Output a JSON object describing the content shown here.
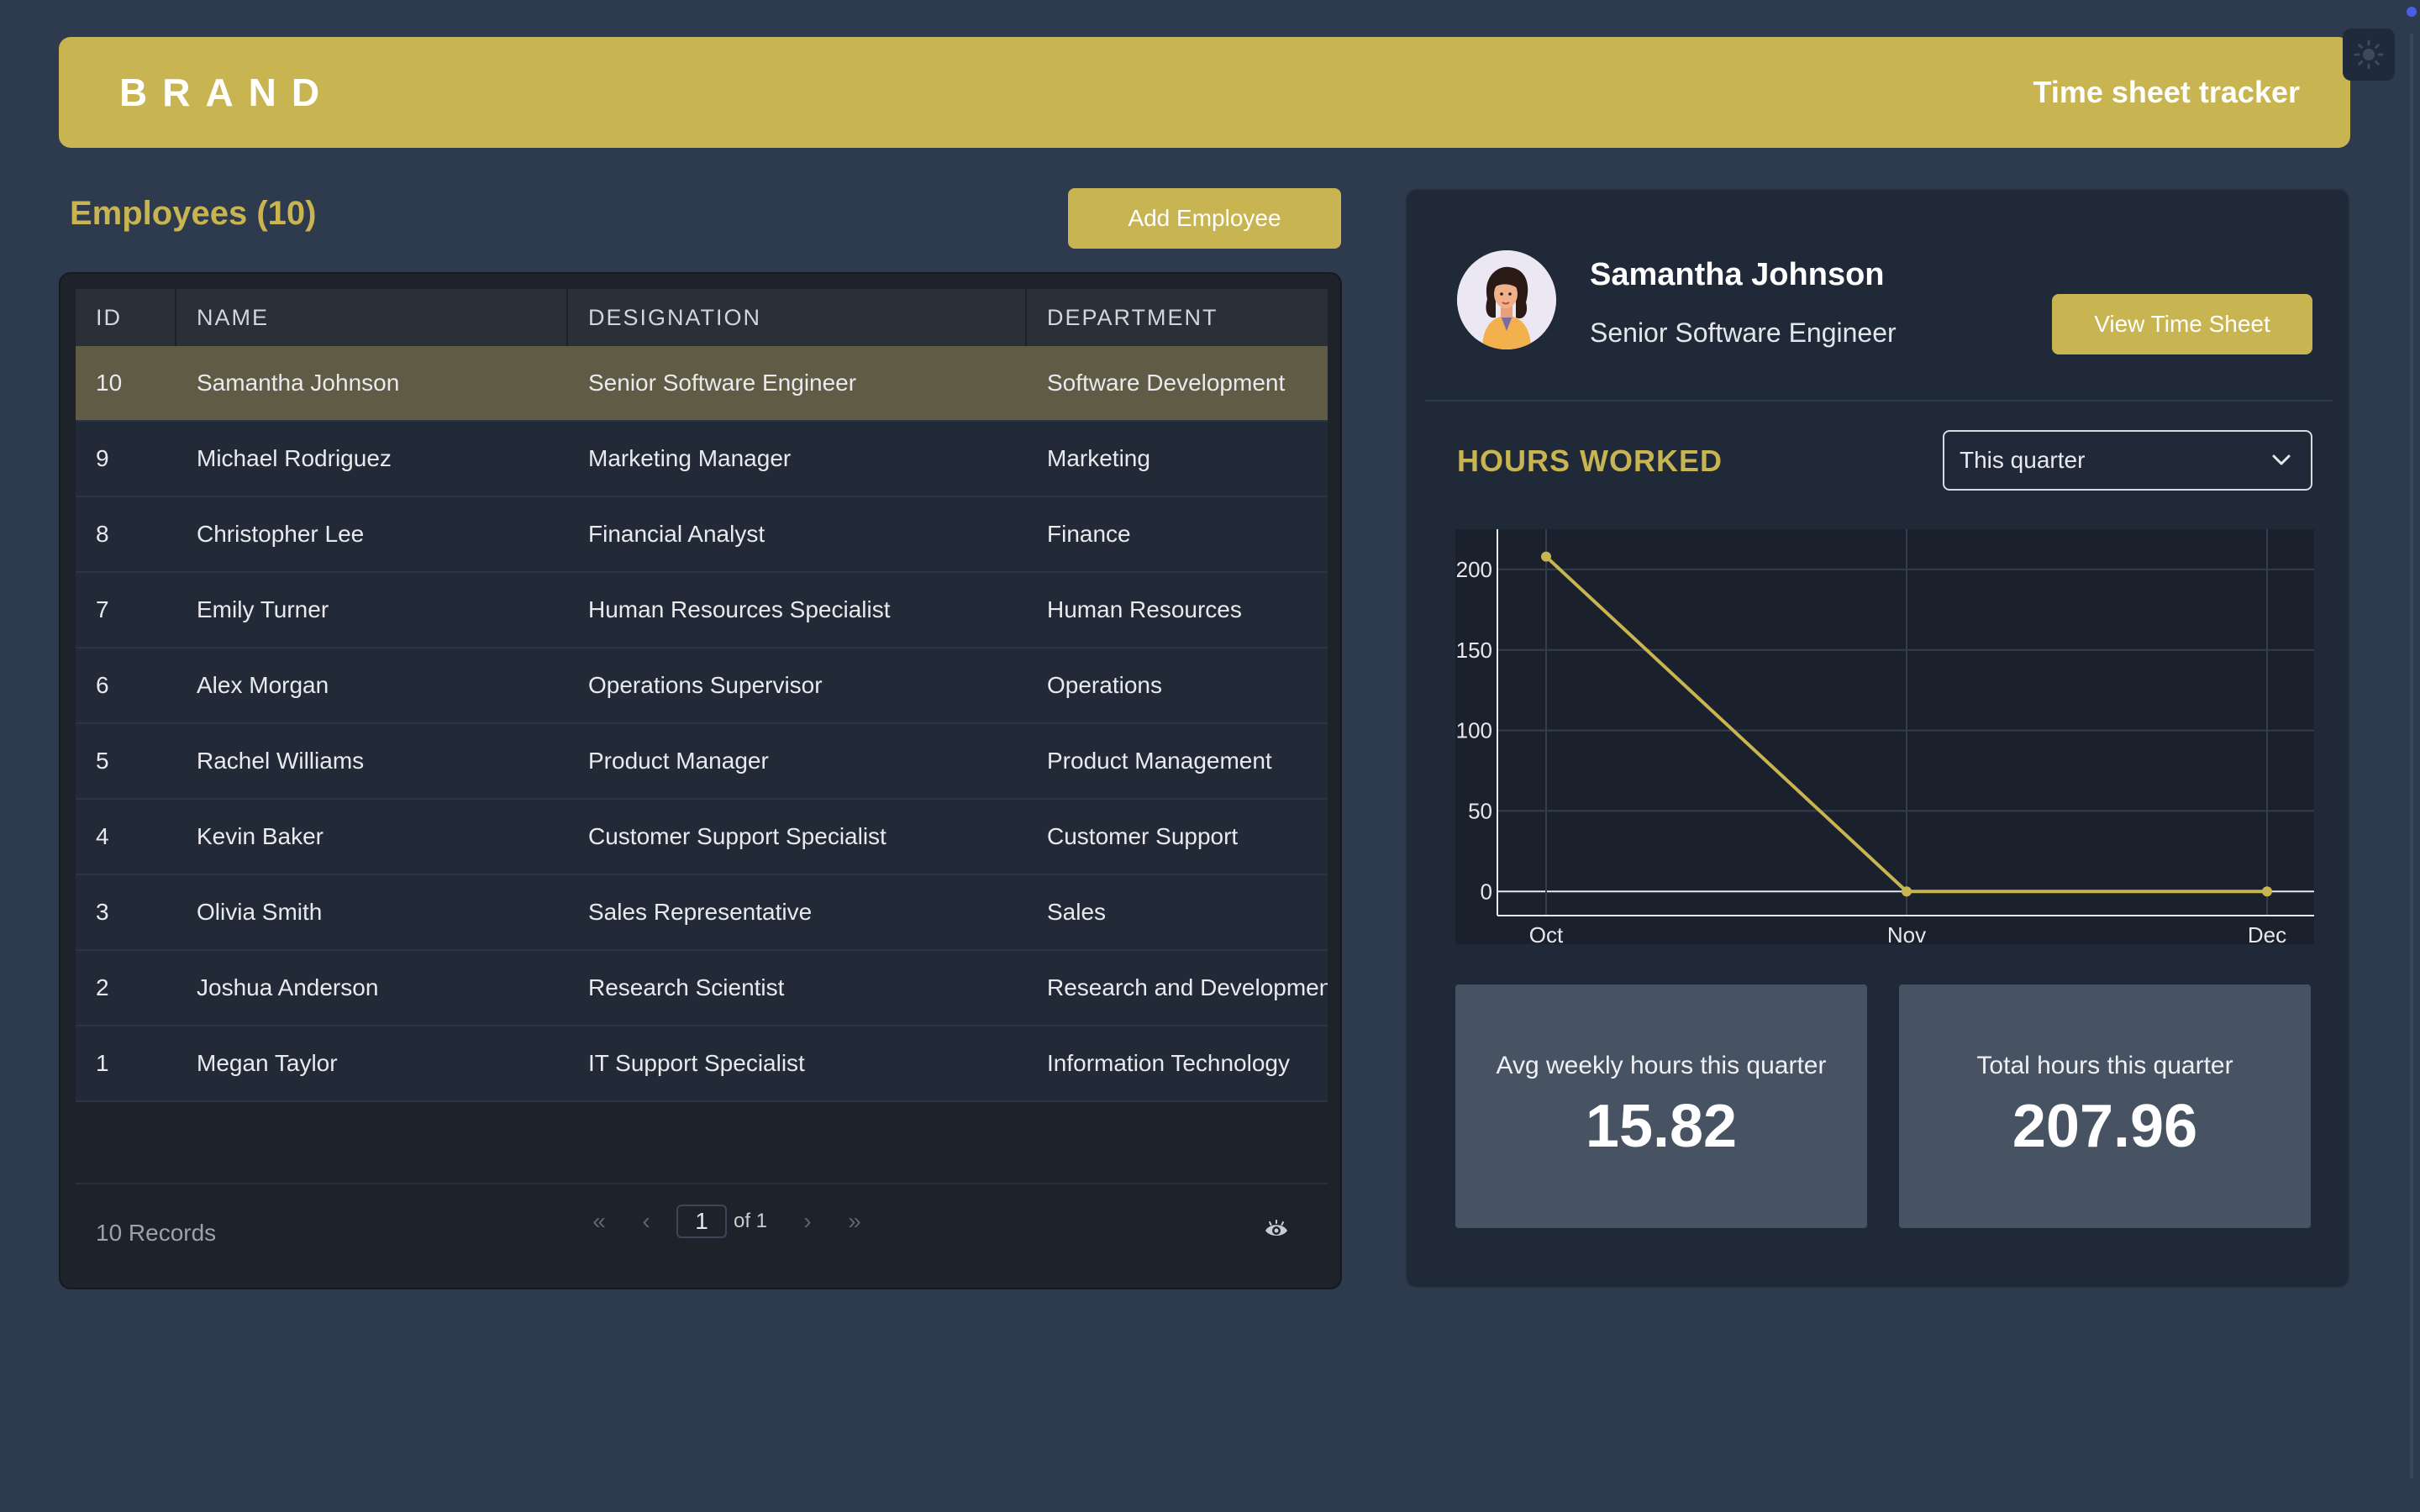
{
  "header": {
    "brand": "BRAND",
    "title": "Time sheet tracker"
  },
  "employees": {
    "title": "Employees (10)",
    "add_button": "Add Employee",
    "columns": [
      "ID",
      "NAME",
      "DESIGNATION",
      "DEPARTMENT"
    ],
    "rows": [
      {
        "id": "10",
        "name": "Samantha Johnson",
        "designation": "Senior Software Engineer",
        "department": "Software Development",
        "selected": true
      },
      {
        "id": "9",
        "name": "Michael Rodriguez",
        "designation": "Marketing Manager",
        "department": "Marketing"
      },
      {
        "id": "8",
        "name": "Christopher Lee",
        "designation": "Financial Analyst",
        "department": "Finance"
      },
      {
        "id": "7",
        "name": "Emily Turner",
        "designation": "Human Resources Specialist",
        "department": "Human Resources"
      },
      {
        "id": "6",
        "name": "Alex Morgan",
        "designation": "Operations Supervisor",
        "department": "Operations"
      },
      {
        "id": "5",
        "name": "Rachel Williams",
        "designation": "Product Manager",
        "department": "Product Management"
      },
      {
        "id": "4",
        "name": "Kevin Baker",
        "designation": "Customer Support Specialist",
        "department": "Customer Support"
      },
      {
        "id": "3",
        "name": "Olivia Smith",
        "designation": "Sales Representative",
        "department": "Sales"
      },
      {
        "id": "2",
        "name": "Joshua Anderson",
        "designation": "Research Scientist",
        "department": "Research and Developmen"
      },
      {
        "id": "1",
        "name": "Megan Taylor",
        "designation": "IT Support Specialist",
        "department": "Information Technology"
      }
    ],
    "footer": {
      "records": "10 Records",
      "page": "1",
      "of": "of 1"
    },
    "icons": {
      "first": "first-page-icon",
      "prev": "prev-page-icon",
      "next": "next-page-icon",
      "last": "last-page-icon",
      "columns": "eye-icon"
    }
  },
  "profile": {
    "name": "Samantha Johnson",
    "role": "Senior Software Engineer",
    "view_button": "View Time Sheet",
    "avatar_icon": "avatar-illustration"
  },
  "hours": {
    "title": "HOURS WORKED",
    "period": "This quarter",
    "avg_label": "Avg weekly hours this quarter",
    "avg_value": "15.82",
    "total_label": "Total hours this quarter",
    "total_value": "207.96"
  },
  "chart_data": {
    "type": "line",
    "title": "",
    "xlabel": "",
    "ylabel": "",
    "categories": [
      "Oct",
      "Nov",
      "Dec"
    ],
    "series": [
      {
        "values": [
          207.96,
          0,
          0
        ]
      }
    ],
    "yticks": [
      0,
      50,
      100,
      150,
      200
    ],
    "ylim": [
      -15,
      225
    ],
    "grid": true,
    "color": "#c8b451"
  },
  "colors": {
    "accent": "#c8b451",
    "background": "#2e3a4d",
    "card": "#1f2938"
  }
}
